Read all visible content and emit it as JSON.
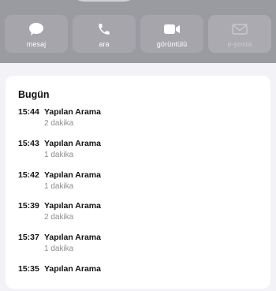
{
  "actions": [
    {
      "label": "mesaj",
      "icon": "message-bubble-icon",
      "enabled": true
    },
    {
      "label": "ara",
      "icon": "phone-icon",
      "enabled": true
    },
    {
      "label": "görüntülü",
      "icon": "video-camera-icon",
      "enabled": true
    },
    {
      "label": "e-posta",
      "icon": "envelope-icon",
      "enabled": false
    }
  ],
  "history": {
    "section": "Bugün",
    "calls": [
      {
        "time": "15:44",
        "type": "Yapılan Arama",
        "duration": "2 dakika"
      },
      {
        "time": "15:43",
        "type": "Yapılan Arama",
        "duration": "1 dakika"
      },
      {
        "time": "15:42",
        "type": "Yapılan Arama",
        "duration": "1 dakika"
      },
      {
        "time": "15:39",
        "type": "Yapılan Arama",
        "duration": "2 dakika"
      },
      {
        "time": "15:37",
        "type": "Yapılan Arama",
        "duration": "1 dakika"
      },
      {
        "time": "15:35",
        "type": "Yapılan Arama",
        "duration": ""
      }
    ]
  },
  "colors": {
    "header_bg": "#9a9aa1",
    "button_bg": "#a5a5ab",
    "page_bg": "#f2f2f7",
    "secondary_text": "#8e8e93"
  }
}
